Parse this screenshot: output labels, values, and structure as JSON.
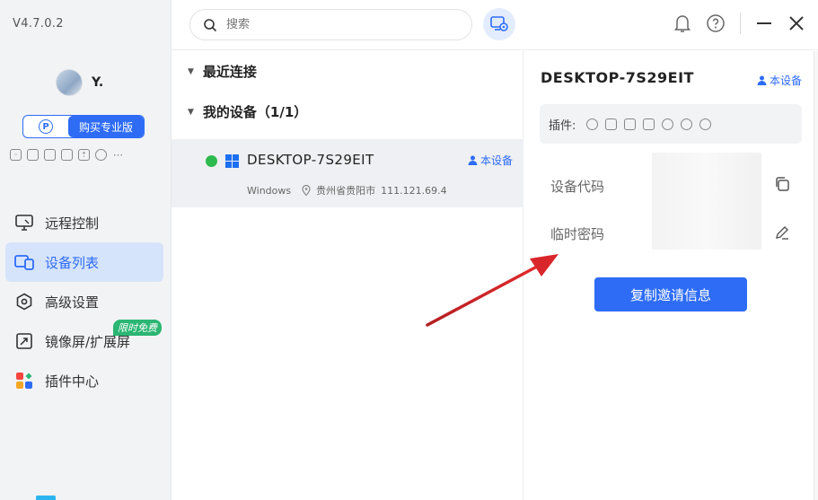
{
  "app": {
    "version": "V4.7.0.2",
    "username": "Y."
  },
  "sidebar": {
    "pro_button_label": "购买专业版",
    "pro_badge": "P",
    "nav": [
      {
        "label": "远程控制",
        "icon": "monitor-remote-icon"
      },
      {
        "label": "设备列表",
        "icon": "device-list-icon"
      },
      {
        "label": "高级设置",
        "icon": "settings-hex-icon"
      },
      {
        "label": "镜像屏/扩展屏",
        "icon": "mirror-screen-icon",
        "badge": "限时免费"
      },
      {
        "label": "插件中心",
        "icon": "plugin-grid-icon"
      }
    ],
    "more_glyph": "···"
  },
  "topbar": {
    "search_placeholder": "搜索"
  },
  "device_list": {
    "recent_label": "最近连接",
    "mine_label": "我的设备（1/1）",
    "device": {
      "name": "DESKTOP-7S29EIT",
      "self_label": "本设备",
      "os": "Windows",
      "location": "贵州省贵阳市",
      "ip": "111.121.69.4",
      "status_color": "#2dbb4e"
    }
  },
  "detail": {
    "title": "DESKTOP-7S29EIT",
    "self_label": "本设备",
    "plugins_label": "插件:",
    "device_code_label": "设备代码",
    "temp_password_label": "临时密码",
    "invite_button": "复制邀请信息"
  },
  "colors": {
    "accent": "#2e6cf6",
    "free_tag": "#2bb673",
    "annotation_arrow": "#d9262b"
  }
}
